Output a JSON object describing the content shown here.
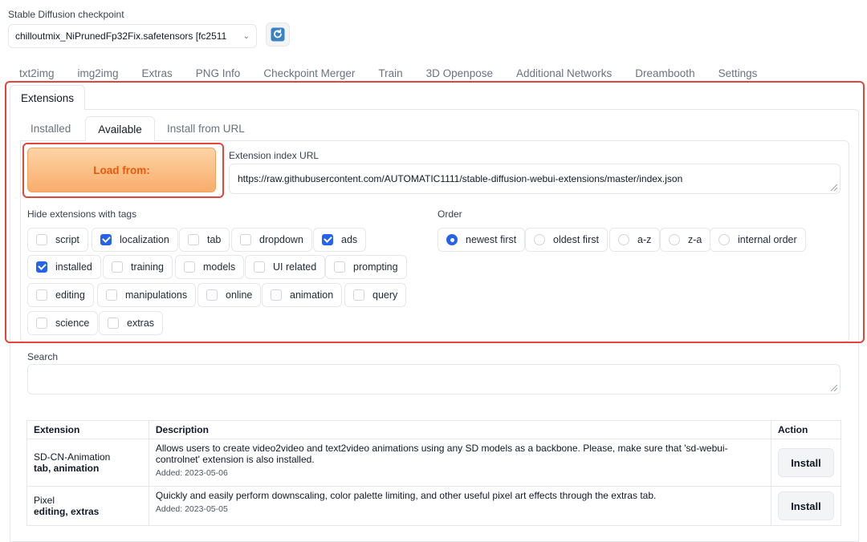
{
  "checkpoint": {
    "label": "Stable Diffusion checkpoint",
    "value": "chilloutmix_NiPrunedFp32Fix.safetensors [fc2511"
  },
  "top_tabs": [
    "txt2img",
    "img2img",
    "Extras",
    "PNG Info",
    "Checkpoint Merger",
    "Train",
    "3D Openpose",
    "Additional Networks",
    "Dreambooth",
    "Settings"
  ],
  "extensions_tab": "Extensions",
  "sub_tabs": {
    "installed": "Installed",
    "available": "Available",
    "install_url": "Install from URL"
  },
  "load_button": "Load from:",
  "index_url": {
    "label": "Extension index URL",
    "value": "https://raw.githubusercontent.com/AUTOMATIC1111/stable-diffusion-webui-extensions/master/index.json"
  },
  "hide_tags": {
    "label": "Hide extensions with tags",
    "items": [
      {
        "label": "script",
        "checked": false
      },
      {
        "label": "localization",
        "checked": true
      },
      {
        "label": "tab",
        "checked": false
      },
      {
        "label": "dropdown",
        "checked": false
      },
      {
        "label": "ads",
        "checked": true
      },
      {
        "label": "installed",
        "checked": true
      },
      {
        "label": "training",
        "checked": false
      },
      {
        "label": "models",
        "checked": false
      },
      {
        "label": "UI related",
        "checked": false
      },
      {
        "label": "prompting",
        "checked": false
      },
      {
        "label": "editing",
        "checked": false
      },
      {
        "label": "manipulations",
        "checked": false
      },
      {
        "label": "online",
        "checked": false
      },
      {
        "label": "animation",
        "checked": false
      },
      {
        "label": "query",
        "checked": false
      },
      {
        "label": "science",
        "checked": false
      },
      {
        "label": "extras",
        "checked": false
      }
    ]
  },
  "order": {
    "label": "Order",
    "options": [
      {
        "label": "newest first",
        "selected": true
      },
      {
        "label": "oldest first",
        "selected": false
      },
      {
        "label": "a-z",
        "selected": false
      },
      {
        "label": "z-a",
        "selected": false
      },
      {
        "label": "internal order",
        "selected": false
      }
    ]
  },
  "search": {
    "label": "Search",
    "value": ""
  },
  "table": {
    "headers": {
      "extension": "Extension",
      "description": "Description",
      "action": "Action"
    },
    "rows": [
      {
        "name": "SD-CN-Animation",
        "tags": "tab, animation",
        "description": "Allows users to create video2video and text2video animations using any SD models as a backbone. Please, make sure that 'sd-webui-controlnet' extension is also installed.",
        "added": "Added: 2023-05-06",
        "action": "Install"
      },
      {
        "name": "Pixel",
        "tags": "editing, extras",
        "description": "Quickly and easily perform downscaling, color palette limiting, and other useful pixel art effects through the extras tab.",
        "added": "Added: 2023-05-05",
        "action": "Install"
      }
    ]
  },
  "colors": {
    "accent": "#2563eb",
    "highlight": "#e0463c",
    "load_text": "#e8590c"
  }
}
